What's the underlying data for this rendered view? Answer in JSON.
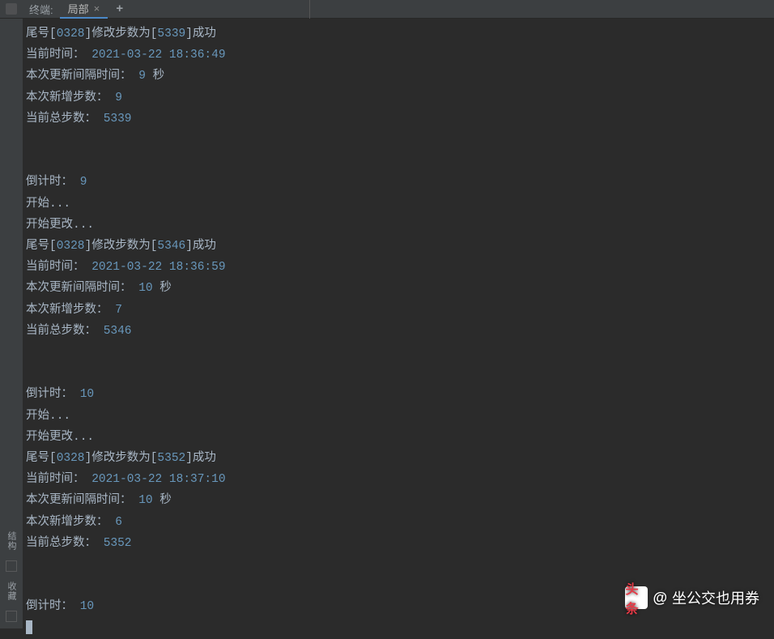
{
  "tabs": {
    "label": "终端:",
    "active": "局部",
    "close": "×",
    "add": "+"
  },
  "rail": {
    "structure": "结构",
    "favorites": "收藏"
  },
  "blocks": [
    {
      "tail": "0328",
      "steps": "5339",
      "time": "2021-03-22 18:36:49",
      "interval": "9",
      "added": "9",
      "total": "5339",
      "countdown_before": null
    },
    {
      "countdown_before": "9",
      "tail": "0328",
      "steps": "5346",
      "time": "2021-03-22 18:36:59",
      "interval": "10",
      "added": "7",
      "total": "5346"
    },
    {
      "countdown_before": "10",
      "tail": "0328",
      "steps": "5352",
      "time": "2021-03-22 18:37:10",
      "interval": "10",
      "added": "6",
      "total": "5352"
    }
  ],
  "trailing_countdown": "10",
  "labels": {
    "modify_prefix": "尾号[",
    "modify_mid": "]修改步数为[",
    "modify_suffix": "]成功",
    "current_time": "当前时间：",
    "interval": "本次更新间隔时间：",
    "seconds": " 秒",
    "added": "本次新增步数：",
    "total": "当前总步数：",
    "countdown": "倒计时：",
    "start": "开始...",
    "start_change": "开始更改..."
  },
  "watermark": {
    "logo": "头条",
    "at": "@",
    "name": "坐公交也用券"
  }
}
